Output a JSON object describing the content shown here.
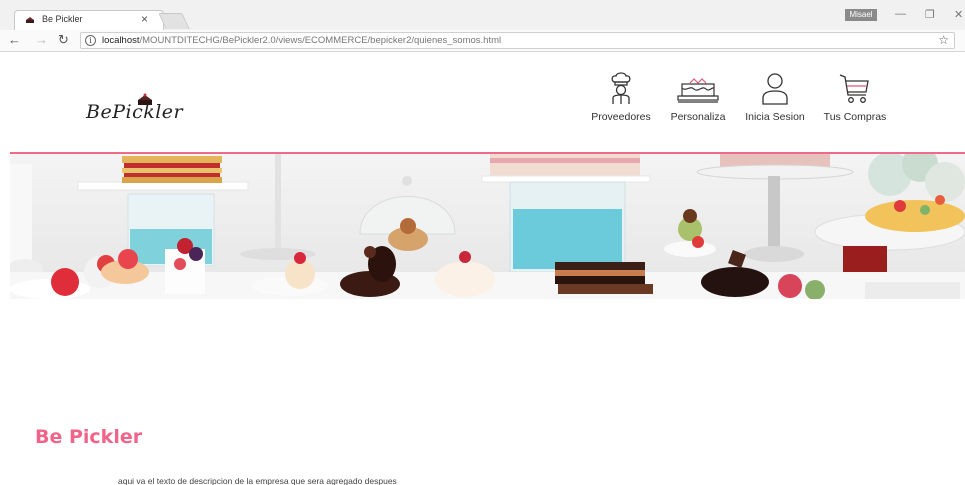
{
  "browser": {
    "tab_title": "Be Pickler",
    "tab_close": "×",
    "user_badge": "Misael",
    "url_host": "localhost",
    "url_path": "/MOUNTDITECHG/BePickler2.0/views/ECOMMERCE/bepicker2/quienes_somos.html",
    "icons": [
      "back-arrow-icon",
      "forward-arrow-icon",
      "reload-icon",
      "info-icon",
      "bookmark-star-icon",
      "minimize-icon",
      "restore-icon",
      "close-icon"
    ]
  },
  "header": {
    "logo_text": "BePickler",
    "nav": [
      {
        "label": "Proveedores",
        "icon": "chef-icon"
      },
      {
        "label": "Personaliza",
        "icon": "cake-icon"
      },
      {
        "label": "Inicia Sesion",
        "icon": "user-icon"
      },
      {
        "label": "Tus Compras",
        "icon": "shopping-cart-icon"
      }
    ]
  },
  "colors": {
    "accent": "#f0648a",
    "rule": "#f06b8a"
  },
  "content": {
    "title": "Be Pickler",
    "description": "aqui va el texto de descripcion de la empresa que sera agregado despues"
  }
}
